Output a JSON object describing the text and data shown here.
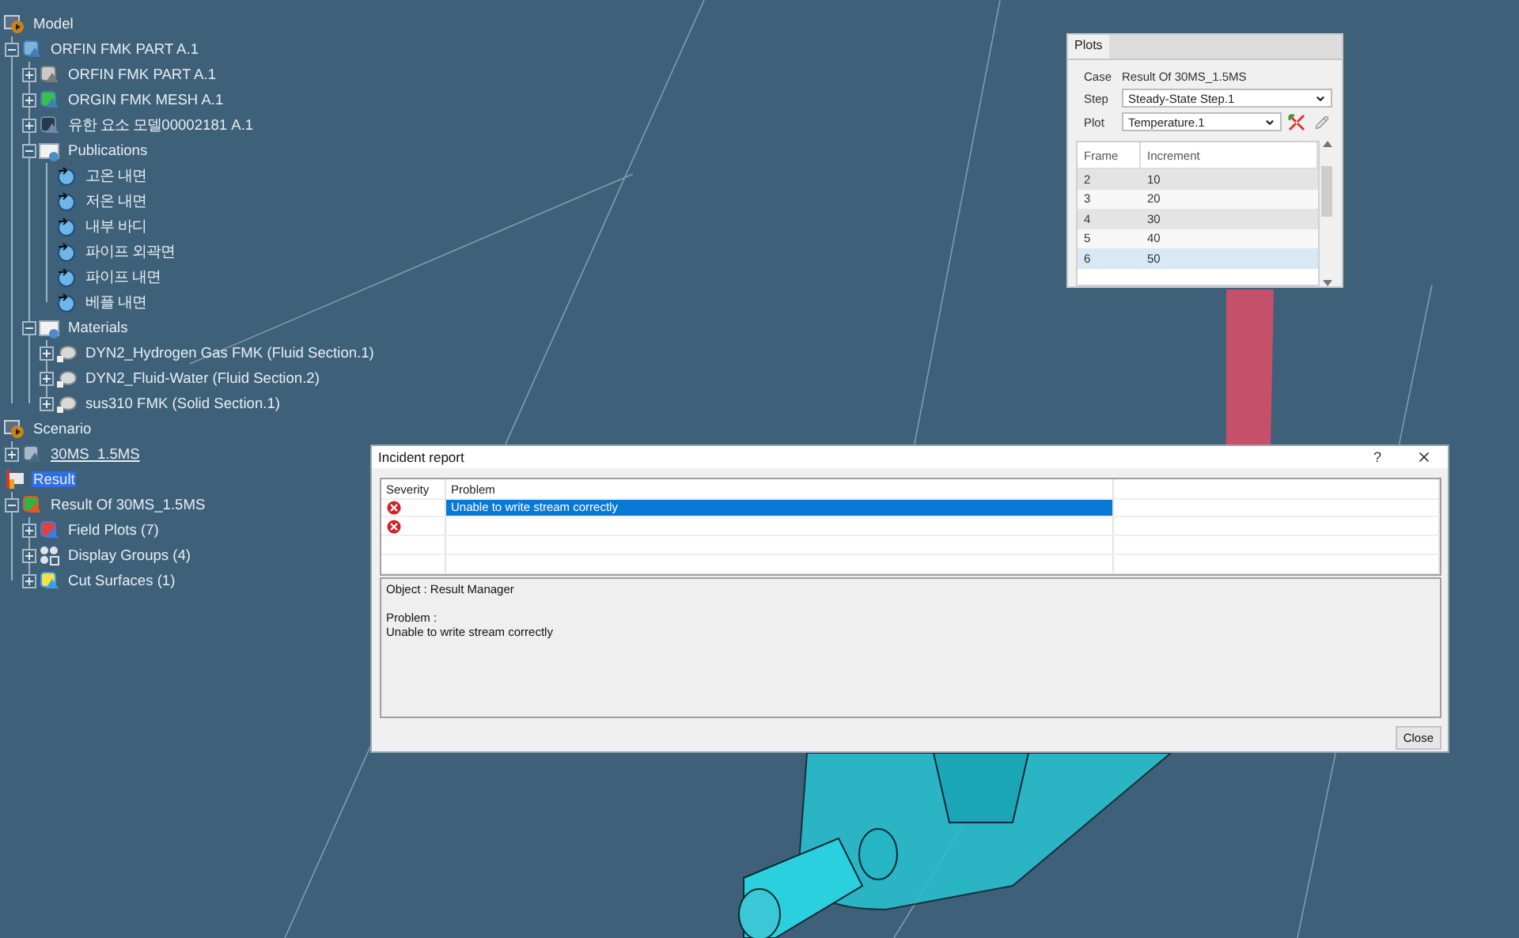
{
  "tree": [
    {
      "label": "Model",
      "kind": "model",
      "children": [
        {
          "label": "ORFIN FMK PART A.1",
          "kind": "product",
          "expanded": true,
          "children": [
            {
              "label": "ORFIN FMK PART A.1",
              "kind": "part",
              "expanded": false
            },
            {
              "label": "ORGIN FMK MESH A.1",
              "kind": "mesh",
              "expanded": false
            },
            {
              "label": "유한 요소 모델00002181 A.1",
              "kind": "fem",
              "expanded": false
            },
            {
              "label": "Publications",
              "kind": "folder",
              "expanded": true,
              "children": [
                {
                  "label": "고온 내면",
                  "kind": "publication"
                },
                {
                  "label": "저온 내면",
                  "kind": "publication"
                },
                {
                  "label": "내부 바디",
                  "kind": "publication"
                },
                {
                  "label": "파이프 외곽면",
                  "kind": "publication"
                },
                {
                  "label": "파이프 내면",
                  "kind": "publication"
                },
                {
                  "label": "베플 내면",
                  "kind": "publication"
                }
              ]
            },
            {
              "label": "Materials",
              "kind": "folder",
              "expanded": true,
              "children": [
                {
                  "label": "DYN2_Hydrogen Gas FMK (Fluid Section.1)",
                  "kind": "material",
                  "expanded": false
                },
                {
                  "label": "DYN2_Fluid-Water (Fluid Section.2)",
                  "kind": "material",
                  "expanded": false
                },
                {
                  "label": "sus310 FMK (Solid Section.1)",
                  "kind": "material",
                  "expanded": false
                }
              ]
            }
          ]
        }
      ]
    },
    {
      "label": "Scenario",
      "kind": "model",
      "children": [
        {
          "label": "30MS_1.5MS",
          "kind": "scenario",
          "expanded": false,
          "link": true
        }
      ]
    },
    {
      "label": "Result",
      "kind": "result",
      "selected": true,
      "children": [
        {
          "label": "Result Of 30MS_1.5MS",
          "kind": "result_of",
          "expanded": true,
          "children": [
            {
              "label": "Field Plots (7)",
              "kind": "field_plots",
              "expanded": false
            },
            {
              "label": "Display Groups (4)",
              "kind": "display_groups",
              "expanded": false
            },
            {
              "label": "Cut Surfaces (1)",
              "kind": "cut_surfaces",
              "expanded": false
            }
          ]
        }
      ]
    }
  ],
  "plots_panel": {
    "tab": "Plots",
    "case_label": "Case",
    "case_value": "Result Of 30MS_1.5MS",
    "step_label": "Step",
    "step_value": "Steady-State Step.1",
    "plot_label": "Plot",
    "plot_value": "Temperature.1",
    "columns": [
      "Frame",
      "Increment"
    ],
    "rows": [
      {
        "frame": "2",
        "increment": "10",
        "selected": false
      },
      {
        "frame": "3",
        "increment": "20",
        "selected": false
      },
      {
        "frame": "4",
        "increment": "30",
        "selected": false
      },
      {
        "frame": "5",
        "increment": "40",
        "selected": false
      },
      {
        "frame": "6",
        "increment": "50",
        "selected": true
      }
    ]
  },
  "incident_dialog": {
    "title": "Incident report",
    "help": "?",
    "columns": [
      "Severity",
      "Problem"
    ],
    "rows": [
      {
        "kind": "error",
        "problem": "Unable to write stream correctly",
        "selected": true
      },
      {
        "kind": "error",
        "selected": false
      }
    ],
    "object_line": "Object : Result Manager",
    "problem_heading": "Problem :",
    "problem_text": "Unable to write stream correctly",
    "close_button": "Close"
  }
}
